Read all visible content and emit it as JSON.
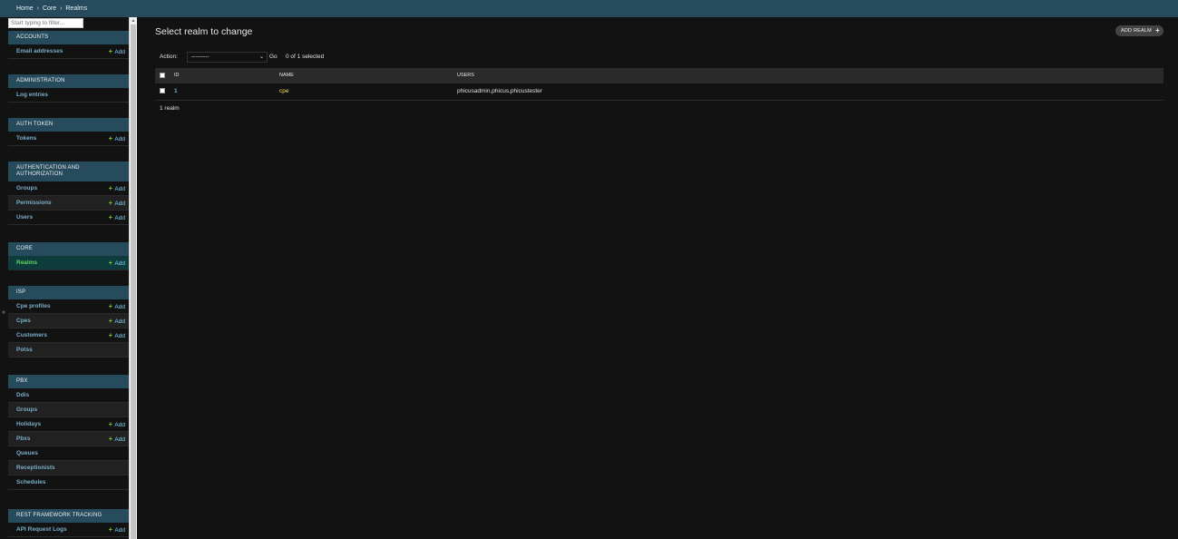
{
  "breadcrumbs": {
    "home": "Home",
    "separator": "›",
    "app": "Core",
    "current": "Realms"
  },
  "sidebar": {
    "filter_placeholder": "Start typing to filter...",
    "add_label": "Add",
    "collapse_toggle": "«",
    "sections": [
      {
        "title": "ACCOUNTS",
        "items": [
          {
            "label": "Email addresses",
            "add": true
          }
        ]
      },
      {
        "title": "ADMINISTRATION",
        "items": [
          {
            "label": "Log entries",
            "add": false
          }
        ]
      },
      {
        "title": "AUTH TOKEN",
        "items": [
          {
            "label": "Tokens",
            "add": true
          }
        ]
      },
      {
        "title": "AUTHENTICATION AND AUTHORIZATION",
        "items": [
          {
            "label": "Groups",
            "add": true
          },
          {
            "label": "Permissions",
            "add": true
          },
          {
            "label": "Users",
            "add": true
          }
        ]
      },
      {
        "title": "CORE",
        "items": [
          {
            "label": "Realms",
            "add": true,
            "current": true
          }
        ]
      },
      {
        "title": "ISP",
        "items": [
          {
            "label": "Cpe profiles",
            "add": true
          },
          {
            "label": "Cpes",
            "add": true
          },
          {
            "label": "Customers",
            "add": true
          },
          {
            "label": "Potss",
            "add": false
          }
        ]
      },
      {
        "title": "PBX",
        "items": [
          {
            "label": "Ddis",
            "add": false
          },
          {
            "label": "Groups",
            "add": false
          },
          {
            "label": "Holidays",
            "add": true
          },
          {
            "label": "Pbxs",
            "add": true
          },
          {
            "label": "Queues",
            "add": false
          },
          {
            "label": "Receptionists",
            "add": false
          },
          {
            "label": "Schedules",
            "add": false
          }
        ]
      },
      {
        "title": "REST FRAMEWORK TRACKING",
        "items": [
          {
            "label": "API Request Logs",
            "add": true
          }
        ]
      }
    ]
  },
  "main": {
    "title": "Select realm to change",
    "add_button": "ADD REALM",
    "add_button_icon": "+",
    "action_label": "Action:",
    "action_selected": "---------",
    "go_label": "Go",
    "counter": "0 of 1 selected",
    "columns": {
      "id": "ID",
      "name": "NAME",
      "users": "USERS"
    },
    "rows": [
      {
        "id": "1",
        "name": "cpe",
        "users": "phicusadmin,phicus,phicustester"
      }
    ],
    "paginator": "1 realm"
  },
  "colors": {
    "header_bg": "#264b5d",
    "link": "#79aec8",
    "accent_yellow": "#f5dd5d",
    "add_green": "#70bf2b",
    "current_row_bg": "#0e3b3b"
  }
}
